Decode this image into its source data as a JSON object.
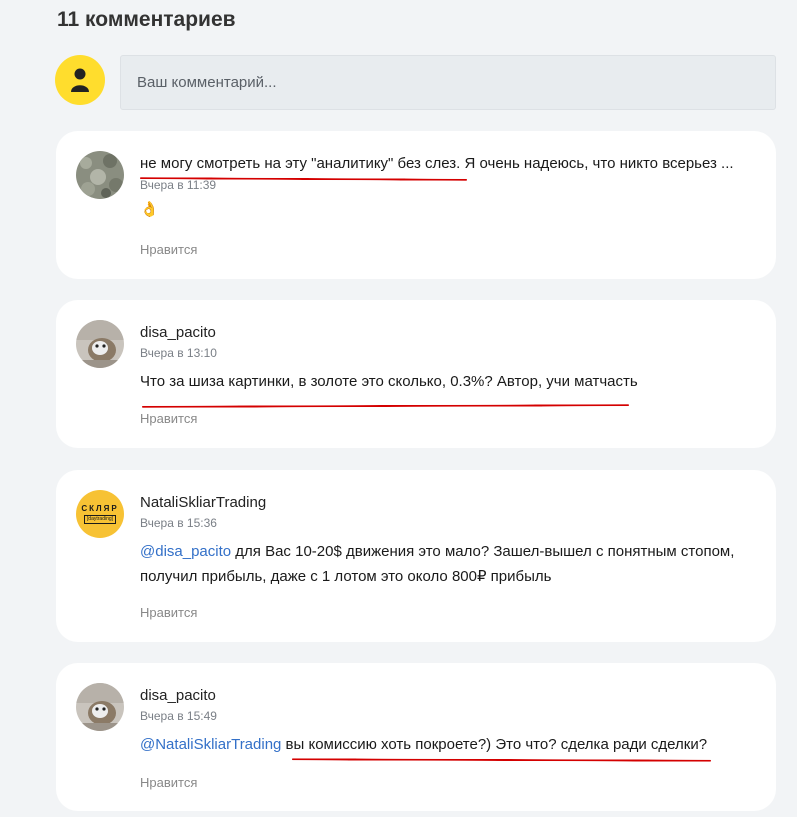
{
  "header": {
    "title": "11 комментариев"
  },
  "composer": {
    "placeholder": "Ваш комментарий..."
  },
  "colors": {
    "annotation": "#d40000",
    "mention": "#3370c8",
    "avatar_yellow": "#ffdd2d"
  },
  "comments": [
    {
      "author": "",
      "time": "Вчера в 11:39",
      "text": "не могу смотреть на эту \"аналитику\" без слез. Я очень надеюсь, что никто всерьез ...",
      "emoji": "👌",
      "like": "Нравится"
    },
    {
      "author": "disa_pacito",
      "time": "Вчера в 13:10",
      "text": "Что за шиза картинки, в золоте это сколько, 0.3%? Автор, учи матчасть",
      "like": "Нравится"
    },
    {
      "author": "NataliSkliarTrading",
      "avatar_text": "СКЛЯР",
      "avatar_subtext": "[daytrading]",
      "time": "Вчера в 15:36",
      "mention": "@disa_pacito",
      "text": " для Вас 10-20$ движения это мало? Зашел-вышел с понятным стопом, получил прибыль, даже с 1 лотом это около 800₽ прибыль",
      "like": "Нравится"
    },
    {
      "author": "disa_pacito",
      "time": "Вчера в 15:49",
      "mention": "@NataliSkliarTrading",
      "text": " вы комиссию хоть покроете?) Это что? сделка ради сделки?",
      "like": "Нравится"
    }
  ]
}
